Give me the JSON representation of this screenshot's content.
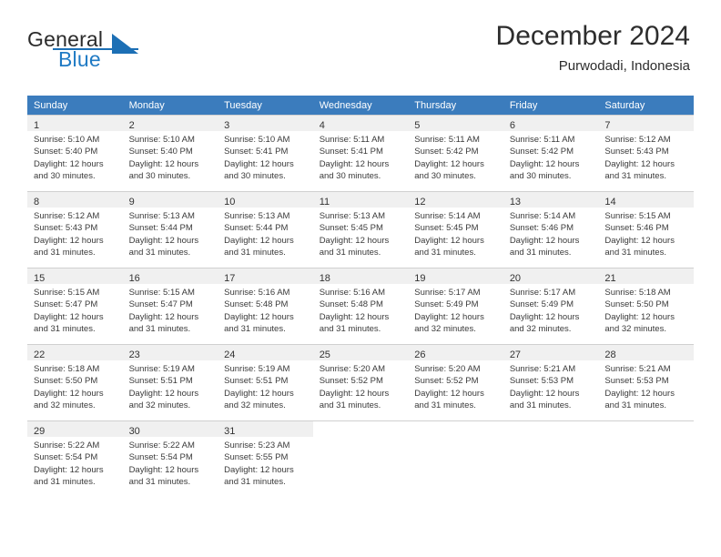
{
  "brand": {
    "word1": "General",
    "word2": "Blue",
    "accent_color": "#1c6fb5"
  },
  "header": {
    "month_title": "December 2024",
    "location": "Purwodadi, Indonesia"
  },
  "calendar": {
    "header_color": "#3b7cbd",
    "weekdays": [
      "Sunday",
      "Monday",
      "Tuesday",
      "Wednesday",
      "Thursday",
      "Friday",
      "Saturday"
    ],
    "weeks": [
      [
        {
          "day": "1",
          "lines": [
            "Sunrise: 5:10 AM",
            "Sunset: 5:40 PM",
            "Daylight: 12 hours",
            "and 30 minutes."
          ]
        },
        {
          "day": "2",
          "lines": [
            "Sunrise: 5:10 AM",
            "Sunset: 5:40 PM",
            "Daylight: 12 hours",
            "and 30 minutes."
          ]
        },
        {
          "day": "3",
          "lines": [
            "Sunrise: 5:10 AM",
            "Sunset: 5:41 PM",
            "Daylight: 12 hours",
            "and 30 minutes."
          ]
        },
        {
          "day": "4",
          "lines": [
            "Sunrise: 5:11 AM",
            "Sunset: 5:41 PM",
            "Daylight: 12 hours",
            "and 30 minutes."
          ]
        },
        {
          "day": "5",
          "lines": [
            "Sunrise: 5:11 AM",
            "Sunset: 5:42 PM",
            "Daylight: 12 hours",
            "and 30 minutes."
          ]
        },
        {
          "day": "6",
          "lines": [
            "Sunrise: 5:11 AM",
            "Sunset: 5:42 PM",
            "Daylight: 12 hours",
            "and 30 minutes."
          ]
        },
        {
          "day": "7",
          "lines": [
            "Sunrise: 5:12 AM",
            "Sunset: 5:43 PM",
            "Daylight: 12 hours",
            "and 31 minutes."
          ]
        }
      ],
      [
        {
          "day": "8",
          "lines": [
            "Sunrise: 5:12 AM",
            "Sunset: 5:43 PM",
            "Daylight: 12 hours",
            "and 31 minutes."
          ]
        },
        {
          "day": "9",
          "lines": [
            "Sunrise: 5:13 AM",
            "Sunset: 5:44 PM",
            "Daylight: 12 hours",
            "and 31 minutes."
          ]
        },
        {
          "day": "10",
          "lines": [
            "Sunrise: 5:13 AM",
            "Sunset: 5:44 PM",
            "Daylight: 12 hours",
            "and 31 minutes."
          ]
        },
        {
          "day": "11",
          "lines": [
            "Sunrise: 5:13 AM",
            "Sunset: 5:45 PM",
            "Daylight: 12 hours",
            "and 31 minutes."
          ]
        },
        {
          "day": "12",
          "lines": [
            "Sunrise: 5:14 AM",
            "Sunset: 5:45 PM",
            "Daylight: 12 hours",
            "and 31 minutes."
          ]
        },
        {
          "day": "13",
          "lines": [
            "Sunrise: 5:14 AM",
            "Sunset: 5:46 PM",
            "Daylight: 12 hours",
            "and 31 minutes."
          ]
        },
        {
          "day": "14",
          "lines": [
            "Sunrise: 5:15 AM",
            "Sunset: 5:46 PM",
            "Daylight: 12 hours",
            "and 31 minutes."
          ]
        }
      ],
      [
        {
          "day": "15",
          "lines": [
            "Sunrise: 5:15 AM",
            "Sunset: 5:47 PM",
            "Daylight: 12 hours",
            "and 31 minutes."
          ]
        },
        {
          "day": "16",
          "lines": [
            "Sunrise: 5:15 AM",
            "Sunset: 5:47 PM",
            "Daylight: 12 hours",
            "and 31 minutes."
          ]
        },
        {
          "day": "17",
          "lines": [
            "Sunrise: 5:16 AM",
            "Sunset: 5:48 PM",
            "Daylight: 12 hours",
            "and 31 minutes."
          ]
        },
        {
          "day": "18",
          "lines": [
            "Sunrise: 5:16 AM",
            "Sunset: 5:48 PM",
            "Daylight: 12 hours",
            "and 31 minutes."
          ]
        },
        {
          "day": "19",
          "lines": [
            "Sunrise: 5:17 AM",
            "Sunset: 5:49 PM",
            "Daylight: 12 hours",
            "and 32 minutes."
          ]
        },
        {
          "day": "20",
          "lines": [
            "Sunrise: 5:17 AM",
            "Sunset: 5:49 PM",
            "Daylight: 12 hours",
            "and 32 minutes."
          ]
        },
        {
          "day": "21",
          "lines": [
            "Sunrise: 5:18 AM",
            "Sunset: 5:50 PM",
            "Daylight: 12 hours",
            "and 32 minutes."
          ]
        }
      ],
      [
        {
          "day": "22",
          "lines": [
            "Sunrise: 5:18 AM",
            "Sunset: 5:50 PM",
            "Daylight: 12 hours",
            "and 32 minutes."
          ]
        },
        {
          "day": "23",
          "lines": [
            "Sunrise: 5:19 AM",
            "Sunset: 5:51 PM",
            "Daylight: 12 hours",
            "and 32 minutes."
          ]
        },
        {
          "day": "24",
          "lines": [
            "Sunrise: 5:19 AM",
            "Sunset: 5:51 PM",
            "Daylight: 12 hours",
            "and 32 minutes."
          ]
        },
        {
          "day": "25",
          "lines": [
            "Sunrise: 5:20 AM",
            "Sunset: 5:52 PM",
            "Daylight: 12 hours",
            "and 31 minutes."
          ]
        },
        {
          "day": "26",
          "lines": [
            "Sunrise: 5:20 AM",
            "Sunset: 5:52 PM",
            "Daylight: 12 hours",
            "and 31 minutes."
          ]
        },
        {
          "day": "27",
          "lines": [
            "Sunrise: 5:21 AM",
            "Sunset: 5:53 PM",
            "Daylight: 12 hours",
            "and 31 minutes."
          ]
        },
        {
          "day": "28",
          "lines": [
            "Sunrise: 5:21 AM",
            "Sunset: 5:53 PM",
            "Daylight: 12 hours",
            "and 31 minutes."
          ]
        }
      ],
      [
        {
          "day": "29",
          "lines": [
            "Sunrise: 5:22 AM",
            "Sunset: 5:54 PM",
            "Daylight: 12 hours",
            "and 31 minutes."
          ]
        },
        {
          "day": "30",
          "lines": [
            "Sunrise: 5:22 AM",
            "Sunset: 5:54 PM",
            "Daylight: 12 hours",
            "and 31 minutes."
          ]
        },
        {
          "day": "31",
          "lines": [
            "Sunrise: 5:23 AM",
            "Sunset: 5:55 PM",
            "Daylight: 12 hours",
            "and 31 minutes."
          ]
        },
        {
          "day": "",
          "lines": []
        },
        {
          "day": "",
          "lines": []
        },
        {
          "day": "",
          "lines": []
        },
        {
          "day": "",
          "lines": []
        }
      ]
    ]
  }
}
